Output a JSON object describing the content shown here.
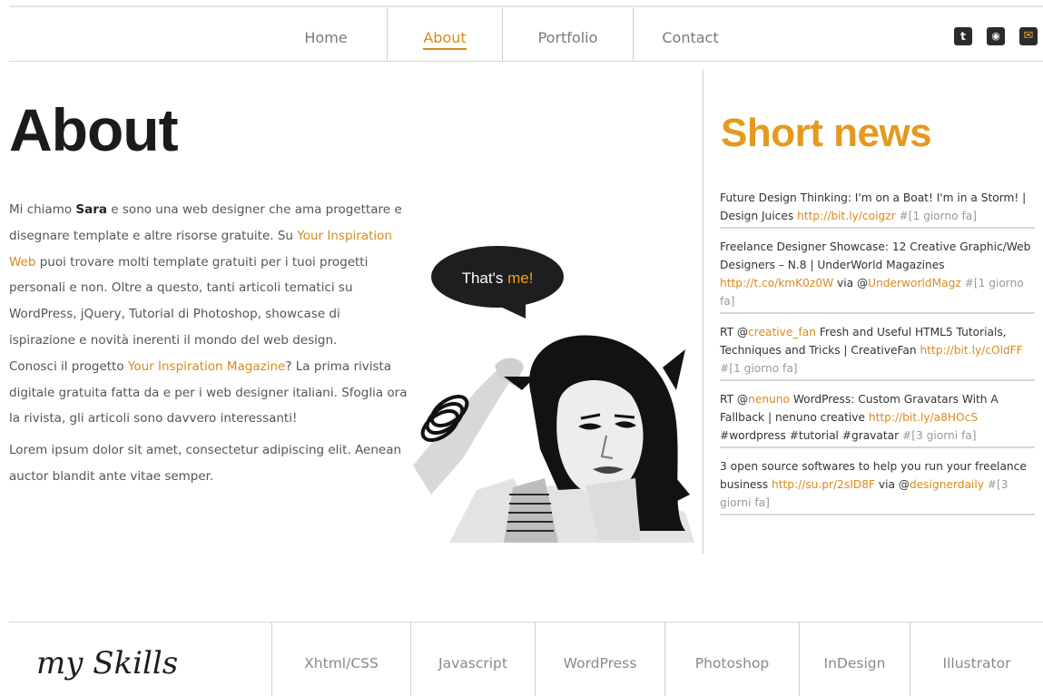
{
  "nav": {
    "items": [
      {
        "label": "Home",
        "active": false
      },
      {
        "label": "About",
        "active": true
      },
      {
        "label": "Portfolio",
        "active": false
      },
      {
        "label": "Contact",
        "active": false
      }
    ],
    "social": [
      {
        "icon": "twitter-icon",
        "glyph": "t"
      },
      {
        "icon": "rss-icon",
        "glyph": "◉"
      },
      {
        "icon": "email-icon",
        "glyph": "✉"
      }
    ]
  },
  "about": {
    "title": "About",
    "p1_intro": "Mi chiamo ",
    "p1_name": "Sara",
    "p1_rest": " e sono una web designer che ama progettare e disegnare template e altre risorse gratuite. Su ",
    "p1_link": "Your Inspiration Web",
    "p1_end": " puoi trovare molti template gratuiti per i tuoi progetti personali e non. Oltre a questo, tanti articoli tematici su WordPress, jQuery, Tutorial di Photoshop, showcase di ispirazione e novità inerenti il mondo del web design.",
    "p2_intro": "Conosci il progetto ",
    "p2_link": "Your Inspiration Magazine",
    "p2_end": "? La prima rivista digitale gratuita fatta da e per i web designer italiani. Sfoglia ora la rivista, gli articoli sono davvero interessanti!",
    "p3": "Lorem ipsum dolor sit amet, consectetur adipiscing elit. Aenean auctor blandit ante vitae semper."
  },
  "bubble": {
    "text_a": "That's ",
    "text_b": "me!"
  },
  "news": {
    "title": "Short news",
    "items": [
      {
        "pre": "Future Design Thinking: I'm on a Boat! I'm in a Storm! | Design Juices ",
        "link": "http://bit.ly/coigzr",
        "post": "",
        "meta": " #[1 giorno fa]"
      },
      {
        "pre": "Freelance Designer Showcase: 12 Creative Graphic/Web Designers – N.8 | UnderWorld Magazines ",
        "link": "http://t.co/kmK0z0W",
        "post": " via @",
        "link2": "UnderworldMagz",
        "meta": " #[1 giorno fa]"
      },
      {
        "pre": "RT @",
        "link": "creative_fan",
        "post": " Fresh and Useful HTML5 Tutorials, Techniques and Tricks | CreativeFan ",
        "link2": "http://bit.ly/cOldFF",
        "meta": " #[1 giorno fa]"
      },
      {
        "pre": "RT @",
        "link": "nenuno",
        "post": " WordPress: Custom Gravatars With A Fallback | nenuno creative ",
        "link2": "http://bit.ly/a8HOcS",
        "post2": " #wordpress #tutorial #gravatar",
        "meta": " #[3 giorni fa]"
      },
      {
        "pre": "3 open source softwares to help you run your freelance business ",
        "link": "http://su.pr/2sID8F",
        "post": " via @",
        "link2": "designerdaily",
        "meta": " #[3 giorni fa]"
      }
    ]
  },
  "skills": {
    "logo": "my Skills",
    "items": [
      "Xhtml/CSS",
      "Javascript",
      "WordPress",
      "Photoshop",
      "InDesign",
      "Illustrator"
    ]
  },
  "colors": {
    "accent": "#d98a1e",
    "news_title": "#e49a1e",
    "text": "#555555",
    "dark": "#1b1b1b"
  }
}
